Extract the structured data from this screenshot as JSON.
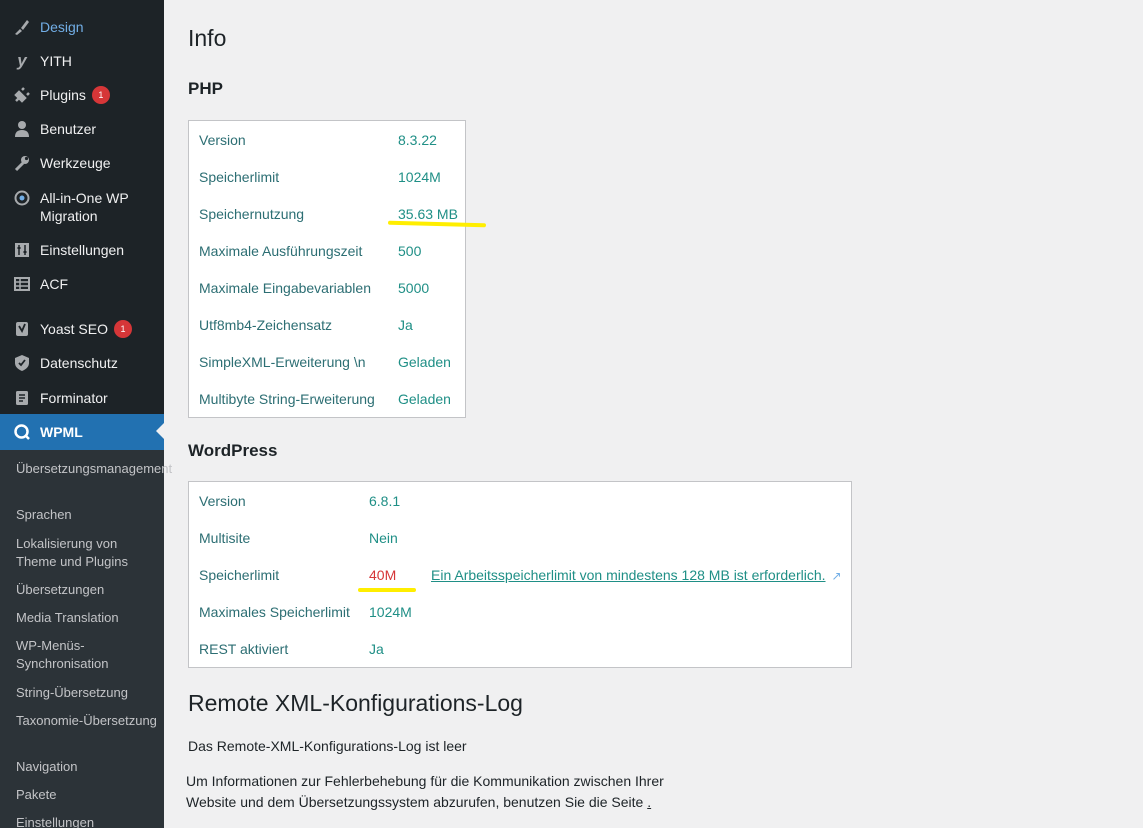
{
  "sidebar": {
    "items": [
      {
        "label": "Design",
        "icon": "paintbrush-icon"
      },
      {
        "label": "YITH",
        "icon": "yith-icon"
      },
      {
        "label": "Plugins",
        "icon": "plugins-icon",
        "badge": "1"
      },
      {
        "label": "Benutzer",
        "icon": "user-icon"
      },
      {
        "label": "Werkzeuge",
        "icon": "wrench-icon"
      },
      {
        "label": "All-in-One WP Migration",
        "icon": "migration-icon"
      },
      {
        "label": "Einstellungen",
        "icon": "settings-icon"
      },
      {
        "label": "ACF",
        "icon": "acf-icon"
      },
      {
        "label": "Yoast SEO",
        "icon": "yoast-icon",
        "badge": "1"
      },
      {
        "label": "Datenschutz",
        "icon": "shield-icon"
      },
      {
        "label": "Forminator",
        "icon": "forminator-icon"
      },
      {
        "label": "WPML",
        "icon": "wpml-icon"
      }
    ],
    "submenu": [
      "Übersetzungsmanagement",
      "Sprachen",
      "Lokalisierung von Theme und Plugins",
      "Übersetzungen",
      "Media Translation",
      "WP-Menüs-Synchronisation",
      "String-Übersetzung",
      "Taxonomie-Übersetzung",
      "Navigation",
      "Pakete",
      "Einstellungen"
    ]
  },
  "page": {
    "title": "Info",
    "php_heading": "PHP",
    "php_rows": [
      {
        "key": "Version",
        "value": "8.3.22"
      },
      {
        "key": "Speicherlimit",
        "value": "1024M"
      },
      {
        "key": "Speichernutzung",
        "value": "35.63 MB"
      },
      {
        "key": "Maximale Ausführungszeit",
        "value": "500"
      },
      {
        "key": "Maximale Eingabevariablen",
        "value": "5000"
      },
      {
        "key": "Utf8mb4-Zeichensatz",
        "value": "Ja"
      },
      {
        "key": "SimpleXML-Erweiterung \\n",
        "value": "Geladen"
      },
      {
        "key": "Multibyte String-Erweiterung",
        "value": "Geladen"
      }
    ],
    "wp_heading": "WordPress",
    "wp_rows": [
      {
        "key": "Version",
        "value": "6.8.1"
      },
      {
        "key": "Multisite",
        "value": "Nein"
      },
      {
        "key": "Speicherlimit",
        "value": "40M",
        "link": "Ein Arbeitsspeicherlimit von mindestens 128 MB ist erforderlich."
      },
      {
        "key": "Maximales Speicherlimit",
        "value": "1024M"
      },
      {
        "key": "REST aktiviert",
        "value": "Ja"
      }
    ],
    "remote_heading": "Remote XML-Konfigurations-Log",
    "remote_empty": "Das Remote-XML-Konfigurations-Log ist leer",
    "remote_info_line1": "Um Informationen zur Fehlerbehebung für die Kommunikation zwischen Ihrer",
    "remote_info_line2": "Website und dem Übersetzungssystem abzurufen, benutzen Sie die Seite",
    "remote_info_link": ".",
    "colors": {
      "sidebar": "#1d2327",
      "accent": "#2271b1",
      "value": "#1f8f86",
      "warning": "#d63638",
      "highlight": "#ffee00"
    }
  }
}
